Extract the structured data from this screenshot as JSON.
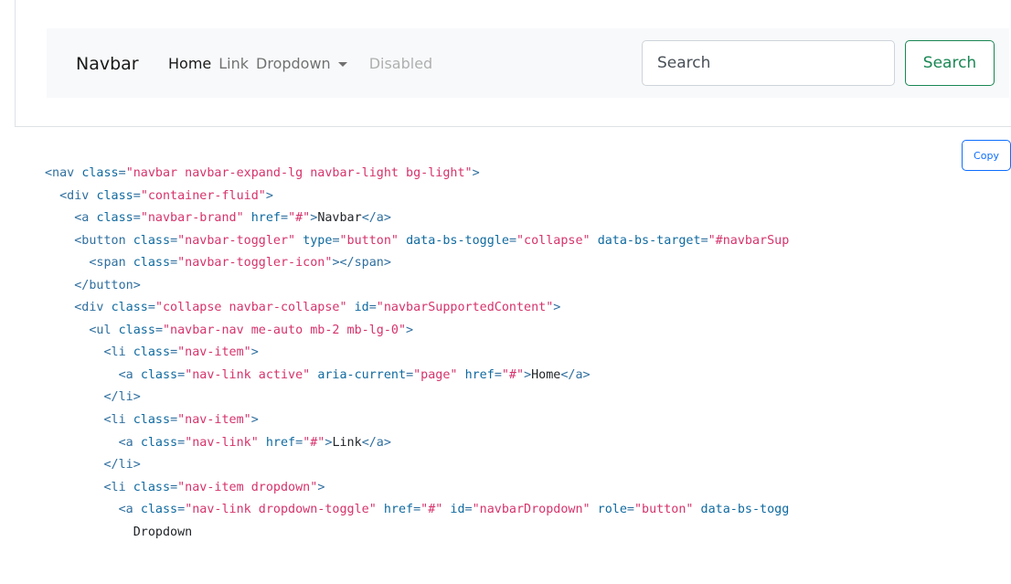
{
  "preview": {
    "brand": "Navbar",
    "nav": [
      {
        "label": "Home",
        "state": "active"
      },
      {
        "label": "Link",
        "state": "normal"
      },
      {
        "label": "Dropdown",
        "state": "dropdown"
      },
      {
        "label": "Disabled",
        "state": "disabled"
      }
    ],
    "search": {
      "placeholder": "Search",
      "value": ""
    },
    "search_button": "Search",
    "colors": {
      "navbar_bg": "#f8f9fa",
      "success": "#198754",
      "primary": "#0d6efd"
    }
  },
  "code": {
    "copy_label": "Copy",
    "lines": [
      [
        [
          "tag",
          "<nav "
        ],
        [
          "attr",
          "class"
        ],
        [
          "tag",
          "="
        ],
        [
          "val",
          "\"navbar navbar-expand-lg navbar-light bg-light\""
        ],
        [
          "tag",
          ">"
        ]
      ],
      [
        [
          "tag",
          "  <div "
        ],
        [
          "attr",
          "class"
        ],
        [
          "tag",
          "="
        ],
        [
          "val",
          "\"container-fluid\""
        ],
        [
          "tag",
          ">"
        ]
      ],
      [
        [
          "tag",
          "    <a "
        ],
        [
          "attr",
          "class"
        ],
        [
          "tag",
          "="
        ],
        [
          "val",
          "\"navbar-brand\" "
        ],
        [
          "attr",
          "href"
        ],
        [
          "tag",
          "="
        ],
        [
          "val",
          "\"#\""
        ],
        [
          "tag",
          ">"
        ],
        [
          "text",
          "Navbar"
        ],
        [
          "tag",
          "</a>"
        ]
      ],
      [
        [
          "tag",
          "    <button "
        ],
        [
          "attr",
          "class"
        ],
        [
          "tag",
          "="
        ],
        [
          "val",
          "\"navbar-toggler\" "
        ],
        [
          "attr",
          "type"
        ],
        [
          "tag",
          "="
        ],
        [
          "val",
          "\"button\" "
        ],
        [
          "attr",
          "data-bs-toggle"
        ],
        [
          "tag",
          "="
        ],
        [
          "val",
          "\"collapse\" "
        ],
        [
          "attr",
          "data-bs-target"
        ],
        [
          "tag",
          "="
        ],
        [
          "val",
          "\"#navbarSup"
        ]
      ],
      [
        [
          "tag",
          "      <span "
        ],
        [
          "attr",
          "class"
        ],
        [
          "tag",
          "="
        ],
        [
          "val",
          "\"navbar-toggler-icon\""
        ],
        [
          "tag",
          "></span>"
        ]
      ],
      [
        [
          "tag",
          "    </button>"
        ]
      ],
      [
        [
          "tag",
          "    <div "
        ],
        [
          "attr",
          "class"
        ],
        [
          "tag",
          "="
        ],
        [
          "val",
          "\"collapse navbar-collapse\" "
        ],
        [
          "attr",
          "id"
        ],
        [
          "tag",
          "="
        ],
        [
          "val",
          "\"navbarSupportedContent\""
        ],
        [
          "tag",
          ">"
        ]
      ],
      [
        [
          "tag",
          "      <ul "
        ],
        [
          "attr",
          "class"
        ],
        [
          "tag",
          "="
        ],
        [
          "val",
          "\"navbar-nav me-auto mb-2 mb-lg-0\""
        ],
        [
          "tag",
          ">"
        ]
      ],
      [
        [
          "tag",
          "        <li "
        ],
        [
          "attr",
          "class"
        ],
        [
          "tag",
          "="
        ],
        [
          "val",
          "\"nav-item\""
        ],
        [
          "tag",
          ">"
        ]
      ],
      [
        [
          "tag",
          "          <a "
        ],
        [
          "attr",
          "class"
        ],
        [
          "tag",
          "="
        ],
        [
          "val",
          "\"nav-link active\" "
        ],
        [
          "attr",
          "aria-current"
        ],
        [
          "tag",
          "="
        ],
        [
          "val",
          "\"page\" "
        ],
        [
          "attr",
          "href"
        ],
        [
          "tag",
          "="
        ],
        [
          "val",
          "\"#\""
        ],
        [
          "tag",
          ">"
        ],
        [
          "text",
          "Home"
        ],
        [
          "tag",
          "</a>"
        ]
      ],
      [
        [
          "tag",
          "        </li>"
        ]
      ],
      [
        [
          "tag",
          "        <li "
        ],
        [
          "attr",
          "class"
        ],
        [
          "tag",
          "="
        ],
        [
          "val",
          "\"nav-item\""
        ],
        [
          "tag",
          ">"
        ]
      ],
      [
        [
          "tag",
          "          <a "
        ],
        [
          "attr",
          "class"
        ],
        [
          "tag",
          "="
        ],
        [
          "val",
          "\"nav-link\" "
        ],
        [
          "attr",
          "href"
        ],
        [
          "tag",
          "="
        ],
        [
          "val",
          "\"#\""
        ],
        [
          "tag",
          ">"
        ],
        [
          "text",
          "Link"
        ],
        [
          "tag",
          "</a>"
        ]
      ],
      [
        [
          "tag",
          "        </li>"
        ]
      ],
      [
        [
          "tag",
          "        <li "
        ],
        [
          "attr",
          "class"
        ],
        [
          "tag",
          "="
        ],
        [
          "val",
          "\"nav-item dropdown\""
        ],
        [
          "tag",
          ">"
        ]
      ],
      [
        [
          "tag",
          "          <a "
        ],
        [
          "attr",
          "class"
        ],
        [
          "tag",
          "="
        ],
        [
          "val",
          "\"nav-link dropdown-toggle\" "
        ],
        [
          "attr",
          "href"
        ],
        [
          "tag",
          "="
        ],
        [
          "val",
          "\"#\" "
        ],
        [
          "attr",
          "id"
        ],
        [
          "tag",
          "="
        ],
        [
          "val",
          "\"navbarDropdown\" "
        ],
        [
          "attr",
          "role"
        ],
        [
          "tag",
          "="
        ],
        [
          "val",
          "\"button\" "
        ],
        [
          "attr",
          "data-bs-togg"
        ]
      ],
      [
        [
          "text",
          "            Dropdown"
        ]
      ]
    ]
  }
}
